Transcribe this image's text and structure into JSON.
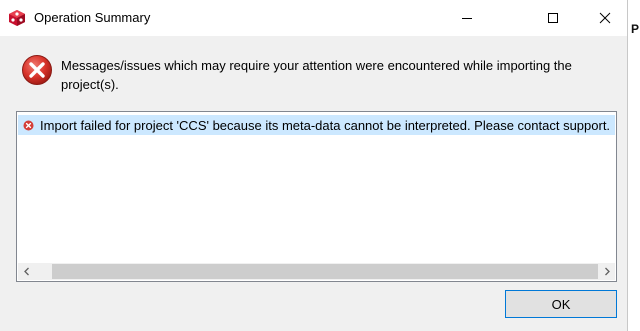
{
  "window": {
    "title": "Operation Summary",
    "controls": [
      "minimize-icon",
      "maximize-icon",
      "close-icon"
    ]
  },
  "header": {
    "icon": "error-icon",
    "message": "Messages/issues which may require your attention were encountered while importing the project(s)."
  },
  "issues": [
    {
      "icon": "error-small-icon",
      "text": "Import failed for project 'CCS' because its meta-data cannot be interpreted. Please contact support."
    }
  ],
  "scrollbar": {
    "left_arrow": "<",
    "right_arrow": ">"
  },
  "buttons": {
    "ok_label": "OK"
  },
  "background": {
    "partial_text": "P"
  },
  "colors": {
    "selection": "#cce8ff",
    "error_red": "#d43f3a",
    "button_border": "#0078d7"
  }
}
